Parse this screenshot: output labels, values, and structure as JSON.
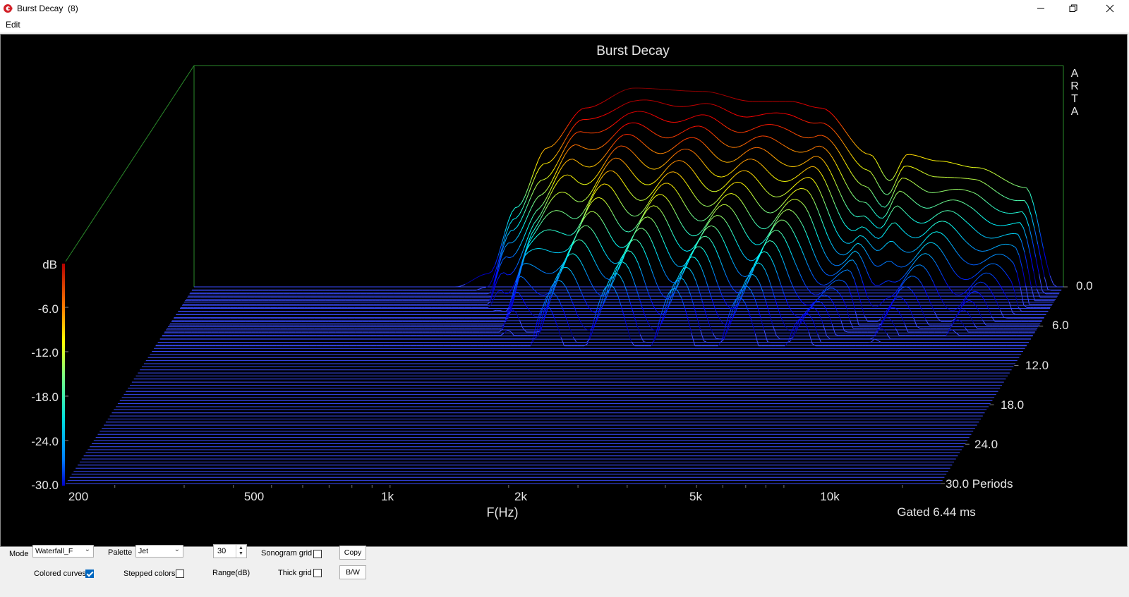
{
  "window": {
    "title": "Burst Decay  (8)",
    "menu": [
      "Edit"
    ]
  },
  "plot": {
    "title": "Burst Decay",
    "watermark": [
      "A",
      "R",
      "T",
      "A"
    ],
    "z_axis_label": "dB",
    "z_ticks": [
      "-6.0",
      "-12.0",
      "-18.0",
      "-24.0",
      "-30.0"
    ],
    "x_ticks": [
      "200",
      "500",
      "1k",
      "2k",
      "5k",
      "10k"
    ],
    "x_label": "F(Hz)",
    "period_ticks": [
      "0.0",
      "6.0",
      "12.0",
      "18.0",
      "24.0",
      "30.0 Periods"
    ],
    "gate_text": "Gated 6.44 ms",
    "background_color": "#000000",
    "floor_color": "#3a4cff"
  },
  "chart_data": {
    "type": "waterfall",
    "title": "Burst Decay",
    "x_label": "F(Hz)",
    "x_scale": "log",
    "x_range": [
      150,
      25000
    ],
    "z_label": "dB",
    "z_range": [
      -30,
      0
    ],
    "depth_label": "Periods",
    "depth_range": [
      0,
      30
    ],
    "palette": "Jet",
    "front_slice_db": [
      {
        "f": 700,
        "db": -30
      },
      {
        "f": 850,
        "db": -28
      },
      {
        "f": 1000,
        "db": -18
      },
      {
        "f": 1200,
        "db": -9
      },
      {
        "f": 1500,
        "db": -3
      },
      {
        "f": 2000,
        "db": 0
      },
      {
        "f": 3000,
        "db": -0.5
      },
      {
        "f": 4000,
        "db": -2
      },
      {
        "f": 5000,
        "db": -2
      },
      {
        "f": 6000,
        "db": -3
      },
      {
        "f": 8000,
        "db": -10
      },
      {
        "f": 9000,
        "db": -14
      },
      {
        "f": 10000,
        "db": -10
      },
      {
        "f": 12000,
        "db": -11
      },
      {
        "f": 15000,
        "db": -12
      },
      {
        "f": 20000,
        "db": -15
      },
      {
        "f": 24000,
        "db": -30
      }
    ]
  },
  "controls": {
    "mode_label": "Mode",
    "mode_value": "Waterfall_F",
    "palette_label": "Palette",
    "palette_value": "Jet",
    "range_value": "30",
    "range_label": "Range(dB)",
    "sonogram_grid_label": "Sonogram grid",
    "sonogram_grid_checked": false,
    "thick_grid_label": "Thick grid",
    "thick_grid_checked": false,
    "colored_curves_label": "Colored curves",
    "colored_curves_checked": true,
    "stepped_colors_label": "Stepped colors",
    "stepped_colors_checked": false,
    "copy_label": "Copy",
    "bw_label": "B/W"
  }
}
